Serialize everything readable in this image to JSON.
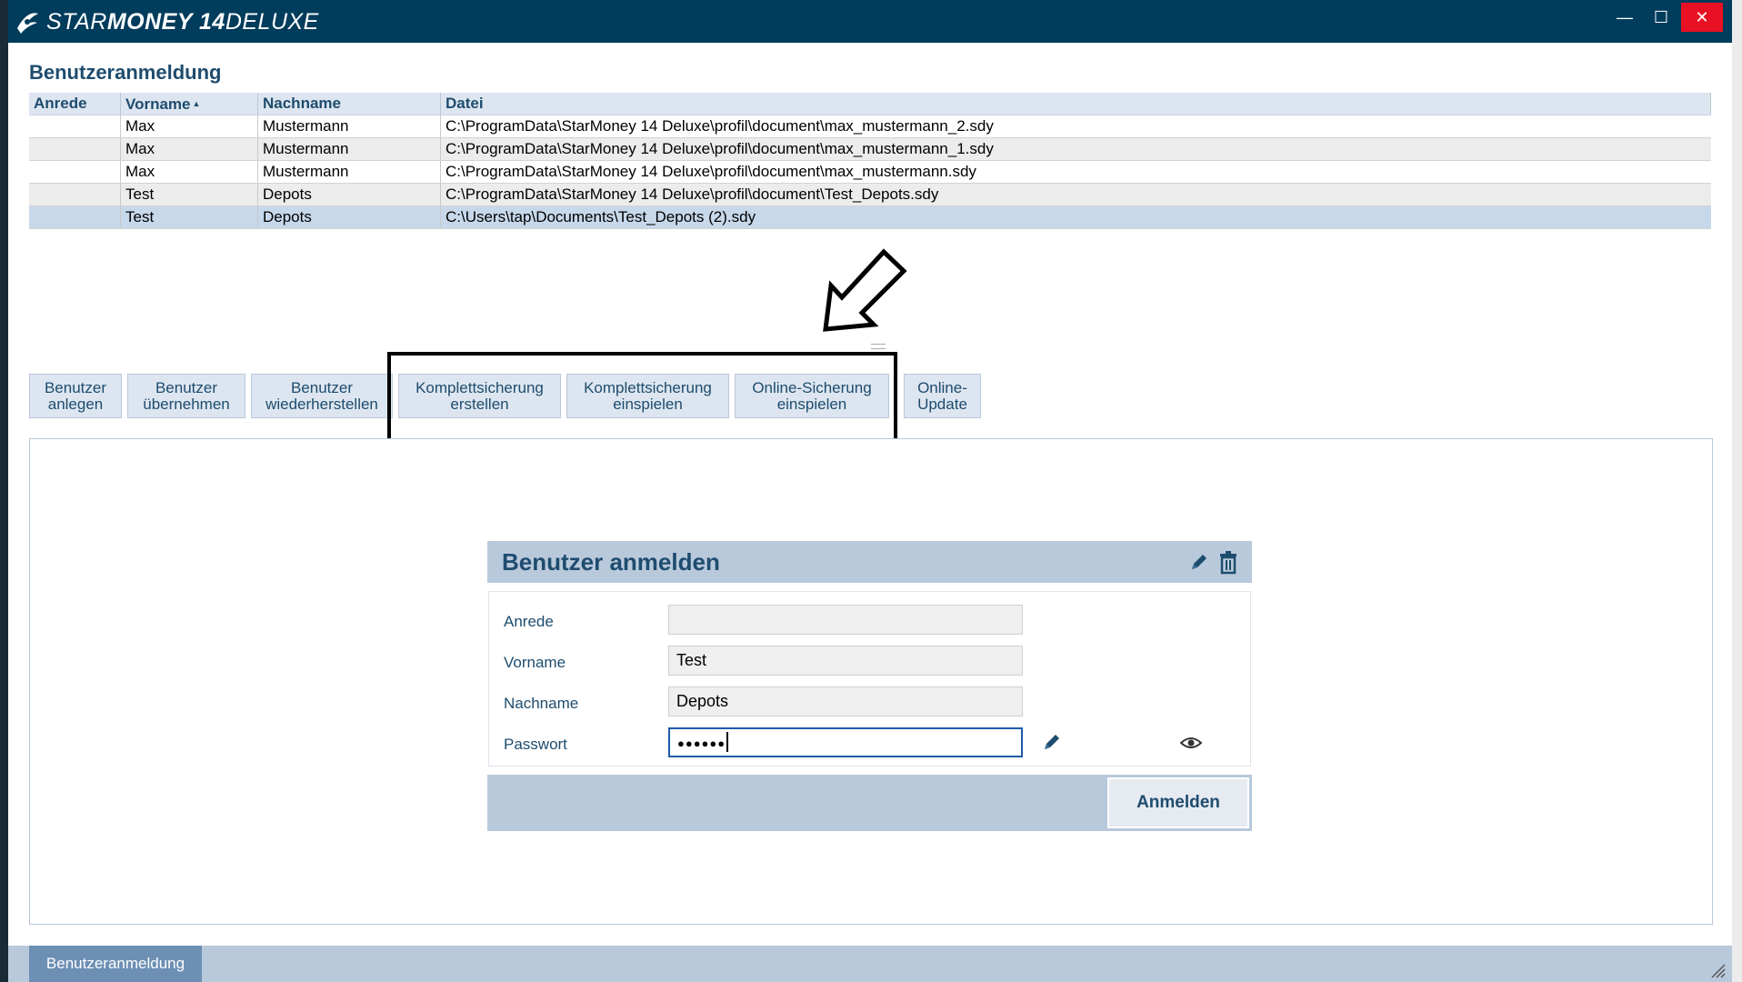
{
  "app": {
    "title_prefix": "STAR",
    "title_bold": "MONEY 14",
    "title_suffix": " DELUXE",
    "controls": {
      "minimize": "—",
      "maximize": "☐",
      "close": "✕"
    }
  },
  "page": {
    "title": "Benutzeranmeldung"
  },
  "table": {
    "columns": [
      "Anrede",
      "Vorname",
      "Nachname",
      "Datei"
    ],
    "sort_indicator": "▲",
    "rows": [
      {
        "anrede": "",
        "vorname": "Max",
        "nachname": "Mustermann",
        "datei": "C:\\ProgramData\\StarMoney 14 Deluxe\\profil\\document\\max_mustermann_2.sdy"
      },
      {
        "anrede": "",
        "vorname": "Max",
        "nachname": "Mustermann",
        "datei": "C:\\ProgramData\\StarMoney 14 Deluxe\\profil\\document\\max_mustermann_1.sdy"
      },
      {
        "anrede": "",
        "vorname": "Max",
        "nachname": "Mustermann",
        "datei": "C:\\ProgramData\\StarMoney 14 Deluxe\\profil\\document\\max_mustermann.sdy"
      },
      {
        "anrede": "",
        "vorname": "Test",
        "nachname": "Depots",
        "datei": "C:\\ProgramData\\StarMoney 14 Deluxe\\profil\\document\\Test_Depots.sdy"
      },
      {
        "anrede": "",
        "vorname": "Test",
        "nachname": "Depots",
        "datei": "C:\\Users\\tap\\Documents\\Test_Depots (2).sdy"
      }
    ]
  },
  "toolbar": {
    "buttons": [
      {
        "line1": "Benutzer",
        "line2": "anlegen"
      },
      {
        "line1": "Benutzer",
        "line2": "übernehmen"
      },
      {
        "line1": "Benutzer",
        "line2": "wiederherstellen"
      },
      {
        "line1": "Komplettsicherung",
        "line2": "erstellen"
      },
      {
        "line1": "Komplettsicherung",
        "line2": "einspielen"
      },
      {
        "line1": "Online-Sicherung",
        "line2": "einspielen"
      },
      {
        "line1": "Online-",
        "line2": "Update"
      }
    ]
  },
  "login": {
    "title": "Benutzer anmelden",
    "fields": {
      "anrede": {
        "label": "Anrede",
        "value": ""
      },
      "vorname": {
        "label": "Vorname",
        "value": "Test"
      },
      "nachname": {
        "label": "Nachname",
        "value": "Depots"
      },
      "passwort": {
        "label": "Passwort",
        "value": "●●●●●●"
      }
    },
    "submit": "Anmelden"
  },
  "status": {
    "tab": "Benutzeranmeldung"
  },
  "colors": {
    "titlebar": "#003c5c",
    "accent": "#1e4c6e",
    "selection": "#c7d8ea",
    "close": "#e81123"
  },
  "icons": [
    "starmoney-logo-icon",
    "edit-icon",
    "trash-icon",
    "eye-icon",
    "arrow-icon",
    "resize-grip-icon"
  ]
}
